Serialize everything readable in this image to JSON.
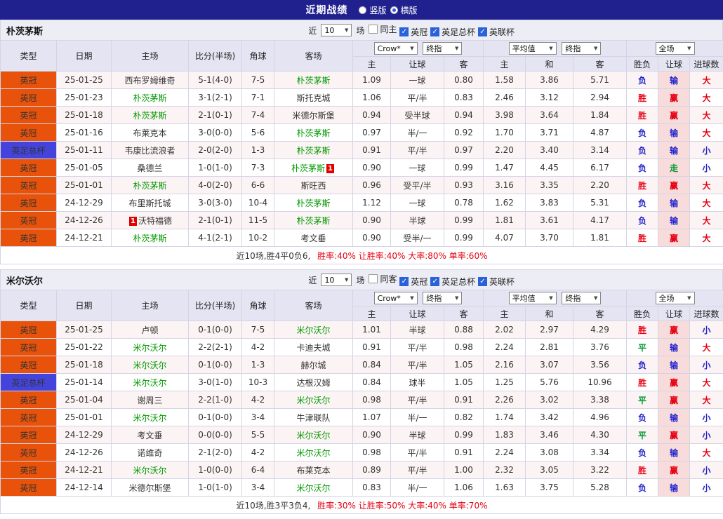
{
  "topbar": {
    "title": "近期战绩",
    "modes": [
      {
        "label": "竖版",
        "selected": false
      },
      {
        "label": "横版",
        "selected": true
      }
    ]
  },
  "filter_labels": {
    "near": "近",
    "count": "10",
    "games": "场"
  },
  "table_header": {
    "cols": [
      "类型",
      "日期",
      "主场",
      "比分(半场)",
      "角球",
      "客场"
    ],
    "dropdowns": {
      "bookmaker": "Crow*",
      "bookmaker_time": "终指",
      "average": "平均值",
      "average_time": "终指",
      "scope": "全场"
    },
    "sub_cols": [
      "主",
      "让球",
      "客",
      "主",
      "和",
      "客",
      "胜负",
      "让球",
      "进球数"
    ]
  },
  "colors": {
    "topbar_bg": "#20208e",
    "header_bg": "#e4e4f2",
    "filter_bg": "#ededf5",
    "row_alt_bg": "#fcf4f4",
    "handicap_result_bg": "#f8dcdc",
    "border": "#d4d4e4",
    "score_red": "#e60012",
    "focus_green": "#009900",
    "win_red": "#e60012",
    "push_green": "#009933",
    "lose_blue": "#2222cc",
    "league_red_bg": "#e8520a",
    "league_blue_bg": "#4444dd",
    "check_blue": "#2a62d9"
  },
  "sections": [
    {
      "team": "朴茨茅斯",
      "checkboxes": [
        {
          "label": "同主",
          "checked": false
        },
        {
          "label": "英冠",
          "checked": true
        },
        {
          "label": "英足总杯",
          "checked": true
        },
        {
          "label": "英联杯",
          "checked": true
        }
      ],
      "rows": [
        {
          "league": "英冠",
          "lc": "red",
          "date": "25-01-25",
          "home": "西布罗姆维奇",
          "hf": false,
          "hb": "",
          "score": "5-1(4-0)",
          "corner": "7-5",
          "away": "朴茨茅斯",
          "af": true,
          "ab": "",
          "ah": [
            "1.09",
            "一球",
            "0.80"
          ],
          "eu": [
            "1.58",
            "3.86",
            "5.71"
          ],
          "res": [
            "负",
            "输",
            "大"
          ]
        },
        {
          "league": "英冠",
          "lc": "red",
          "date": "25-01-23",
          "home": "朴茨茅斯",
          "hf": true,
          "hb": "",
          "score": "3-1(2-1)",
          "corner": "7-1",
          "away": "斯托克城",
          "af": false,
          "ab": "",
          "ah": [
            "1.06",
            "平/半",
            "0.83"
          ],
          "eu": [
            "2.46",
            "3.12",
            "2.94"
          ],
          "res": [
            "胜",
            "赢",
            "大"
          ]
        },
        {
          "league": "英冠",
          "lc": "red",
          "date": "25-01-18",
          "home": "朴茨茅斯",
          "hf": true,
          "hb": "",
          "score": "2-1(0-1)",
          "corner": "7-4",
          "away": "米德尔斯堡",
          "af": false,
          "ab": "",
          "ah": [
            "0.94",
            "受半球",
            "0.94"
          ],
          "eu": [
            "3.98",
            "3.64",
            "1.84"
          ],
          "res": [
            "胜",
            "赢",
            "大"
          ]
        },
        {
          "league": "英冠",
          "lc": "red",
          "date": "25-01-16",
          "home": "布莱克本",
          "hf": false,
          "hb": "",
          "score": "3-0(0-0)",
          "corner": "5-6",
          "away": "朴茨茅斯",
          "af": true,
          "ab": "",
          "ah": [
            "0.97",
            "半/一",
            "0.92"
          ],
          "eu": [
            "1.70",
            "3.71",
            "4.87"
          ],
          "res": [
            "负",
            "输",
            "大"
          ]
        },
        {
          "league": "英足总杯",
          "lc": "blue",
          "date": "25-01-11",
          "home": "韦康比流浪者",
          "hf": false,
          "hb": "",
          "score": "2-0(2-0)",
          "corner": "1-3",
          "away": "朴茨茅斯",
          "af": true,
          "ab": "",
          "ah": [
            "0.91",
            "平/半",
            "0.97"
          ],
          "eu": [
            "2.20",
            "3.40",
            "3.14"
          ],
          "res": [
            "负",
            "输",
            "小"
          ]
        },
        {
          "league": "英冠",
          "lc": "red",
          "date": "25-01-05",
          "home": "桑德兰",
          "hf": false,
          "hb": "",
          "score": "1-0(1-0)",
          "corner": "7-3",
          "away": "朴茨茅斯",
          "af": true,
          "ab": "1",
          "ah": [
            "0.90",
            "一球",
            "0.99"
          ],
          "eu": [
            "1.47",
            "4.45",
            "6.17"
          ],
          "res": [
            "负",
            "走",
            "小"
          ]
        },
        {
          "league": "英冠",
          "lc": "red",
          "date": "25-01-01",
          "home": "朴茨茅斯",
          "hf": true,
          "hb": "",
          "score": "4-0(2-0)",
          "corner": "6-6",
          "away": "斯旺西",
          "af": false,
          "ab": "",
          "ah": [
            "0.96",
            "受平/半",
            "0.93"
          ],
          "eu": [
            "3.16",
            "3.35",
            "2.20"
          ],
          "res": [
            "胜",
            "赢",
            "大"
          ]
        },
        {
          "league": "英冠",
          "lc": "red",
          "date": "24-12-29",
          "home": "布里斯托城",
          "hf": false,
          "hb": "",
          "score": "3-0(3-0)",
          "corner": "10-4",
          "away": "朴茨茅斯",
          "af": true,
          "ab": "",
          "ah": [
            "1.12",
            "一球",
            "0.78"
          ],
          "eu": [
            "1.62",
            "3.83",
            "5.31"
          ],
          "res": [
            "负",
            "输",
            "大"
          ]
        },
        {
          "league": "英冠",
          "lc": "red",
          "date": "24-12-26",
          "home": "沃特福德",
          "hf": false,
          "hb": "1",
          "score": "2-1(0-1)",
          "corner": "11-5",
          "away": "朴茨茅斯",
          "af": true,
          "ab": "",
          "ah": [
            "0.90",
            "半球",
            "0.99"
          ],
          "eu": [
            "1.81",
            "3.61",
            "4.17"
          ],
          "res": [
            "负",
            "输",
            "大"
          ]
        },
        {
          "league": "英冠",
          "lc": "red",
          "date": "24-12-21",
          "home": "朴茨茅斯",
          "hf": true,
          "hb": "",
          "score": "4-1(2-1)",
          "corner": "10-2",
          "away": "考文垂",
          "af": false,
          "ab": "",
          "ah": [
            "0.90",
            "受半/一",
            "0.99"
          ],
          "eu": [
            "4.07",
            "3.70",
            "1.81"
          ],
          "res": [
            "胜",
            "赢",
            "大"
          ]
        }
      ],
      "summary_left": "近10场,胜4平0负6,",
      "summary_right": "胜率:40% 让胜率:40% 大率:80% 单率:60%"
    },
    {
      "team": "米尔沃尔",
      "checkboxes": [
        {
          "label": "同客",
          "checked": false
        },
        {
          "label": "英冠",
          "checked": true
        },
        {
          "label": "英足总杯",
          "checked": true
        },
        {
          "label": "英联杯",
          "checked": true
        }
      ],
      "rows": [
        {
          "league": "英冠",
          "lc": "red",
          "date": "25-01-25",
          "home": "卢顿",
          "hf": false,
          "hb": "",
          "score": "0-1(0-0)",
          "corner": "7-5",
          "away": "米尔沃尔",
          "af": true,
          "ab": "",
          "ah": [
            "1.01",
            "半球",
            "0.88"
          ],
          "eu": [
            "2.02",
            "2.97",
            "4.29"
          ],
          "res": [
            "胜",
            "赢",
            "小"
          ]
        },
        {
          "league": "英冠",
          "lc": "red",
          "date": "25-01-22",
          "home": "米尔沃尔",
          "hf": true,
          "hb": "",
          "score": "2-2(2-1)",
          "corner": "4-2",
          "away": "卡迪夫城",
          "af": false,
          "ab": "",
          "ah": [
            "0.91",
            "平/半",
            "0.98"
          ],
          "eu": [
            "2.24",
            "2.81",
            "3.76"
          ],
          "res": [
            "平",
            "输",
            "大"
          ]
        },
        {
          "league": "英冠",
          "lc": "red",
          "date": "25-01-18",
          "home": "米尔沃尔",
          "hf": true,
          "hb": "",
          "score": "0-1(0-0)",
          "corner": "1-3",
          "away": "赫尔城",
          "af": false,
          "ab": "",
          "ah": [
            "0.84",
            "平/半",
            "1.05"
          ],
          "eu": [
            "2.16",
            "3.07",
            "3.56"
          ],
          "res": [
            "负",
            "输",
            "小"
          ]
        },
        {
          "league": "英足总杯",
          "lc": "blue",
          "date": "25-01-14",
          "home": "米尔沃尔",
          "hf": true,
          "hb": "",
          "score": "3-0(1-0)",
          "corner": "10-3",
          "away": "达根汉姆",
          "af": false,
          "ab": "",
          "ah": [
            "0.84",
            "球半",
            "1.05"
          ],
          "eu": [
            "1.25",
            "5.76",
            "10.96"
          ],
          "res": [
            "胜",
            "赢",
            "大"
          ]
        },
        {
          "league": "英冠",
          "lc": "red",
          "date": "25-01-04",
          "home": "谢周三",
          "hf": false,
          "hb": "",
          "score": "2-2(1-0)",
          "corner": "4-2",
          "away": "米尔沃尔",
          "af": true,
          "ab": "",
          "ah": [
            "0.98",
            "平/半",
            "0.91"
          ],
          "eu": [
            "2.26",
            "3.02",
            "3.38"
          ],
          "res": [
            "平",
            "赢",
            "大"
          ]
        },
        {
          "league": "英冠",
          "lc": "red",
          "date": "25-01-01",
          "home": "米尔沃尔",
          "hf": true,
          "hb": "",
          "score": "0-1(0-0)",
          "corner": "3-4",
          "away": "牛津联队",
          "af": false,
          "ab": "",
          "ah": [
            "1.07",
            "半/一",
            "0.82"
          ],
          "eu": [
            "1.74",
            "3.42",
            "4.96"
          ],
          "res": [
            "负",
            "输",
            "小"
          ]
        },
        {
          "league": "英冠",
          "lc": "red",
          "date": "24-12-29",
          "home": "考文垂",
          "hf": false,
          "hb": "",
          "score": "0-0(0-0)",
          "corner": "5-5",
          "away": "米尔沃尔",
          "af": true,
          "ab": "",
          "ah": [
            "0.90",
            "半球",
            "0.99"
          ],
          "eu": [
            "1.83",
            "3.46",
            "4.30"
          ],
          "res": [
            "平",
            "赢",
            "小"
          ]
        },
        {
          "league": "英冠",
          "lc": "red",
          "date": "24-12-26",
          "home": "诺维奇",
          "hf": false,
          "hb": "",
          "score": "2-1(2-0)",
          "corner": "4-2",
          "away": "米尔沃尔",
          "af": true,
          "ab": "",
          "ah": [
            "0.98",
            "平/半",
            "0.91"
          ],
          "eu": [
            "2.24",
            "3.08",
            "3.34"
          ],
          "res": [
            "负",
            "输",
            "大"
          ]
        },
        {
          "league": "英冠",
          "lc": "red",
          "date": "24-12-21",
          "home": "米尔沃尔",
          "hf": true,
          "hb": "",
          "score": "1-0(0-0)",
          "corner": "6-4",
          "away": "布莱克本",
          "af": false,
          "ab": "",
          "ah": [
            "0.89",
            "平/半",
            "1.00"
          ],
          "eu": [
            "2.32",
            "3.05",
            "3.22"
          ],
          "res": [
            "胜",
            "赢",
            "小"
          ]
        },
        {
          "league": "英冠",
          "lc": "red",
          "date": "24-12-14",
          "home": "米德尔斯堡",
          "hf": false,
          "hb": "",
          "score": "1-0(1-0)",
          "corner": "3-4",
          "away": "米尔沃尔",
          "af": true,
          "ab": "",
          "ah": [
            "0.83",
            "半/一",
            "1.06"
          ],
          "eu": [
            "1.63",
            "3.75",
            "5.28"
          ],
          "res": [
            "负",
            "输",
            "小"
          ]
        }
      ],
      "summary_left": "近10场,胜3平3负4,",
      "summary_right": "胜率:30% 让胜率:50% 大率:40% 单率:70%"
    }
  ]
}
